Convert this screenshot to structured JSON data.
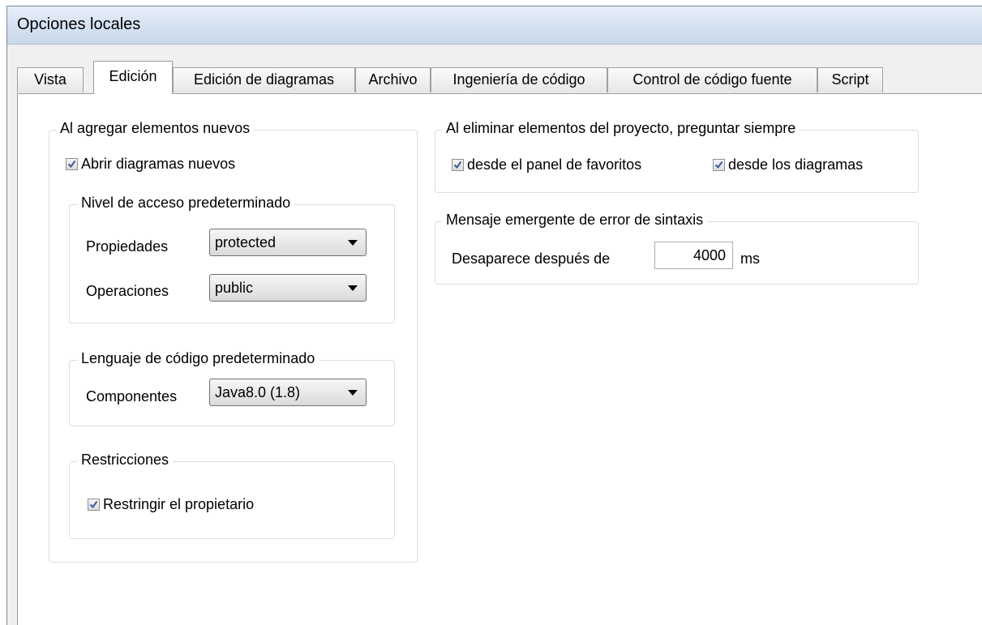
{
  "window": {
    "title": "Opciones locales"
  },
  "tabs": [
    {
      "label": "Vista"
    },
    {
      "label": "Edición"
    },
    {
      "label": "Edición de diagramas"
    },
    {
      "label": "Archivo"
    },
    {
      "label": "Ingeniería de código"
    },
    {
      "label": "Control de código fuente"
    },
    {
      "label": "Script"
    }
  ],
  "active_tab": "Edición",
  "add_elements": {
    "legend": "Al agregar elementos nuevos",
    "open_new_diagrams": {
      "label": "Abrir diagramas nuevos",
      "checked": true
    },
    "access_level": {
      "legend": "Nivel de acceso predeterminado",
      "properties": {
        "label": "Propiedades",
        "value": "protected"
      },
      "operations": {
        "label": "Operaciones",
        "value": "public"
      }
    },
    "code_language": {
      "legend": "Lenguaje de código predeterminado",
      "components": {
        "label": "Componentes",
        "value": "Java8.0 (1.8)"
      }
    },
    "restrictions": {
      "legend": "Restricciones",
      "restrict_owner": {
        "label": "Restringir el propietario",
        "checked": true
      }
    }
  },
  "delete_elements": {
    "legend": "Al eliminar elementos del proyecto, preguntar siempre",
    "from_favorites": {
      "label": "desde el panel de favoritos",
      "checked": true
    },
    "from_diagrams": {
      "label": "desde los diagramas",
      "checked": true
    }
  },
  "syntax_error": {
    "legend": "Mensaje emergente de error de sintaxis",
    "disappears_label": "Desaparece después de",
    "value": "4000",
    "unit": "ms"
  },
  "colors": {
    "check_mark": "#3a5a9c",
    "titlebar": "#d6e2f2"
  },
  "icons": {
    "checkbox": "check-icon",
    "dropdown": "chevron-down-icon"
  }
}
